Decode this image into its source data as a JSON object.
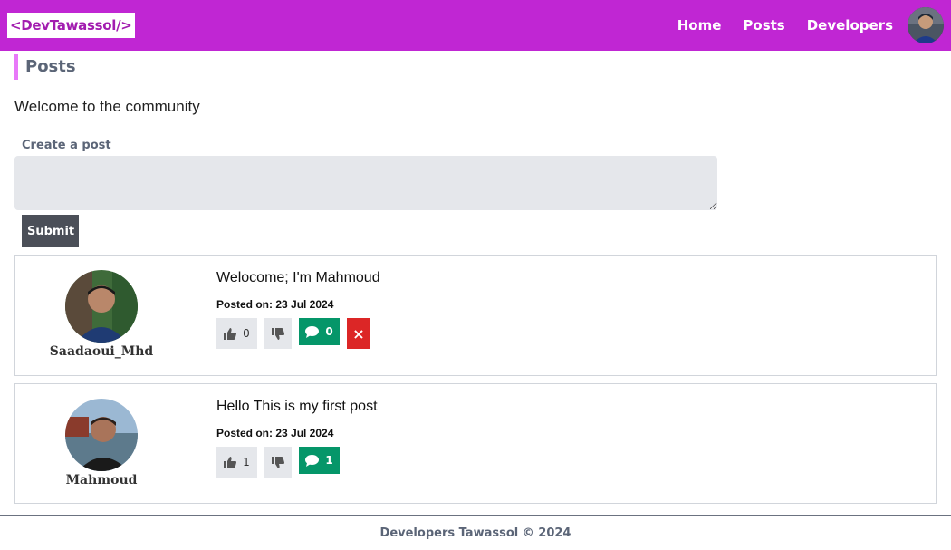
{
  "navbar": {
    "logo": "<DevTawassol/>",
    "links": [
      "Home",
      "Posts",
      "Developers"
    ]
  },
  "page": {
    "title": "Posts",
    "welcome": "Welcome to the community"
  },
  "create_post": {
    "label": "Create a post",
    "placeholder": "",
    "submit_label": "Submit"
  },
  "posts": [
    {
      "author": "Saadaoui_Mhd",
      "text": "Welocome; I'm Mahmoud",
      "date": "Posted on: 23 Jul 2024",
      "likes": "0",
      "comments": "0",
      "delete_label": "×"
    },
    {
      "author": "Mahmoud",
      "text": "Hello This is my first post",
      "date": "Posted on: 23 Jul 2024",
      "likes": "1",
      "comments": "1"
    }
  ],
  "footer": {
    "text": "Developers Tawassol © 2024"
  },
  "colors": {
    "navbar": "#c026d3",
    "accent": "#e879f9",
    "comment": "#059669",
    "delete": "#dc2626",
    "submit": "#4b4f58"
  }
}
